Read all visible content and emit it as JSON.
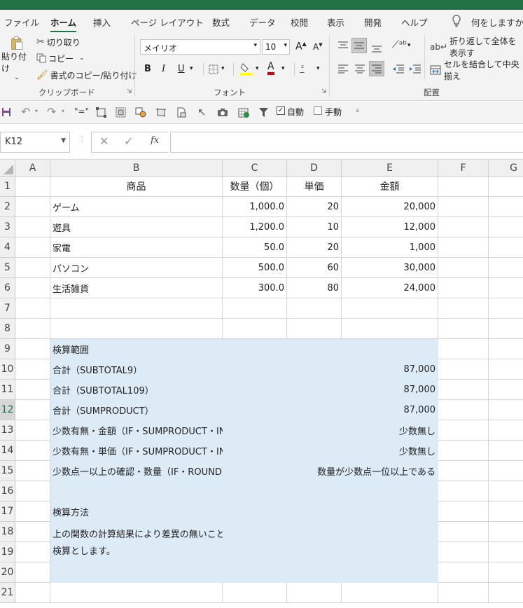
{
  "ribbon_tabs": [
    "ファイル",
    "ホーム",
    "挿入",
    "ページ レイアウト",
    "数式",
    "データ",
    "校閲",
    "表示",
    "開発",
    "ヘルプ"
  ],
  "tell_me": "何をしますか",
  "clipboard": {
    "paste": "貼り付け",
    "cut": "切り取り",
    "copy": "コピー",
    "format_painter": "書式のコピー/貼り付け",
    "group": "クリップボード"
  },
  "font": {
    "name": "メイリオ",
    "size": "10",
    "bold": "B",
    "italic": "I",
    "underline": "U",
    "color_letter": "A",
    "group": "フォント",
    "grow": "A",
    "shrink": "A"
  },
  "alignment": {
    "wrap": "折り返して全体を表示す",
    "merge": "セルを結合して中央揃え",
    "group": "配置"
  },
  "qat": {
    "auto_label": "自動",
    "manual_label": "手動"
  },
  "formula_bar": {
    "name_box": "K12",
    "fx": "fx",
    "content": ""
  },
  "columns": [
    "A",
    "B",
    "C",
    "D",
    "E",
    "F",
    "G"
  ],
  "rows": [
    "1",
    "2",
    "3",
    "4",
    "5",
    "6",
    "7",
    "8",
    "9",
    "10",
    "11",
    "12",
    "13",
    "14",
    "15",
    "16",
    "17",
    "18",
    "19",
    "20",
    "21"
  ],
  "table": {
    "headers": [
      "商品",
      "数量（個）",
      "単価",
      "金額"
    ],
    "items": [
      [
        "ゲーム",
        "1,000.0",
        "20",
        "20,000"
      ],
      [
        "遊具",
        "1,200.0",
        "10",
        "12,000"
      ],
      [
        "家電",
        "50.0",
        "20",
        "1,000"
      ],
      [
        "パソコン",
        "500.0",
        "60",
        "30,000"
      ],
      [
        "生活雑貨",
        "300.0",
        "80",
        "24,000"
      ]
    ]
  },
  "verify": {
    "title": "検算範囲",
    "rows": [
      [
        "合計（SUBTOTAL9）",
        "87,000"
      ],
      [
        "合計（SUBTOTAL109）",
        "87,000"
      ],
      [
        "合計（SUMPRODUCT）",
        "87,000"
      ],
      [
        "少数有無・金額（IF・SUMPRODUCT・INT）",
        "少数無し"
      ],
      [
        "少数有無・単価（IF・SUMPRODUCT・INT）",
        "少数無し"
      ],
      [
        "少数点一以上の確認・数量（IF・ROUND）",
        "数量が少数点一位以上である"
      ]
    ],
    "method_title": "検算方法",
    "method_line1": "上の関数の計算結果により差異の無いことの確認と、端数による小数計算の誤差を確認の上、",
    "method_line2": "検算とします。"
  },
  "colors": {
    "accent": "#217346",
    "highlight": "#ddebf7",
    "fill_yellow": "#ffff00",
    "font_red": "#e00000"
  }
}
